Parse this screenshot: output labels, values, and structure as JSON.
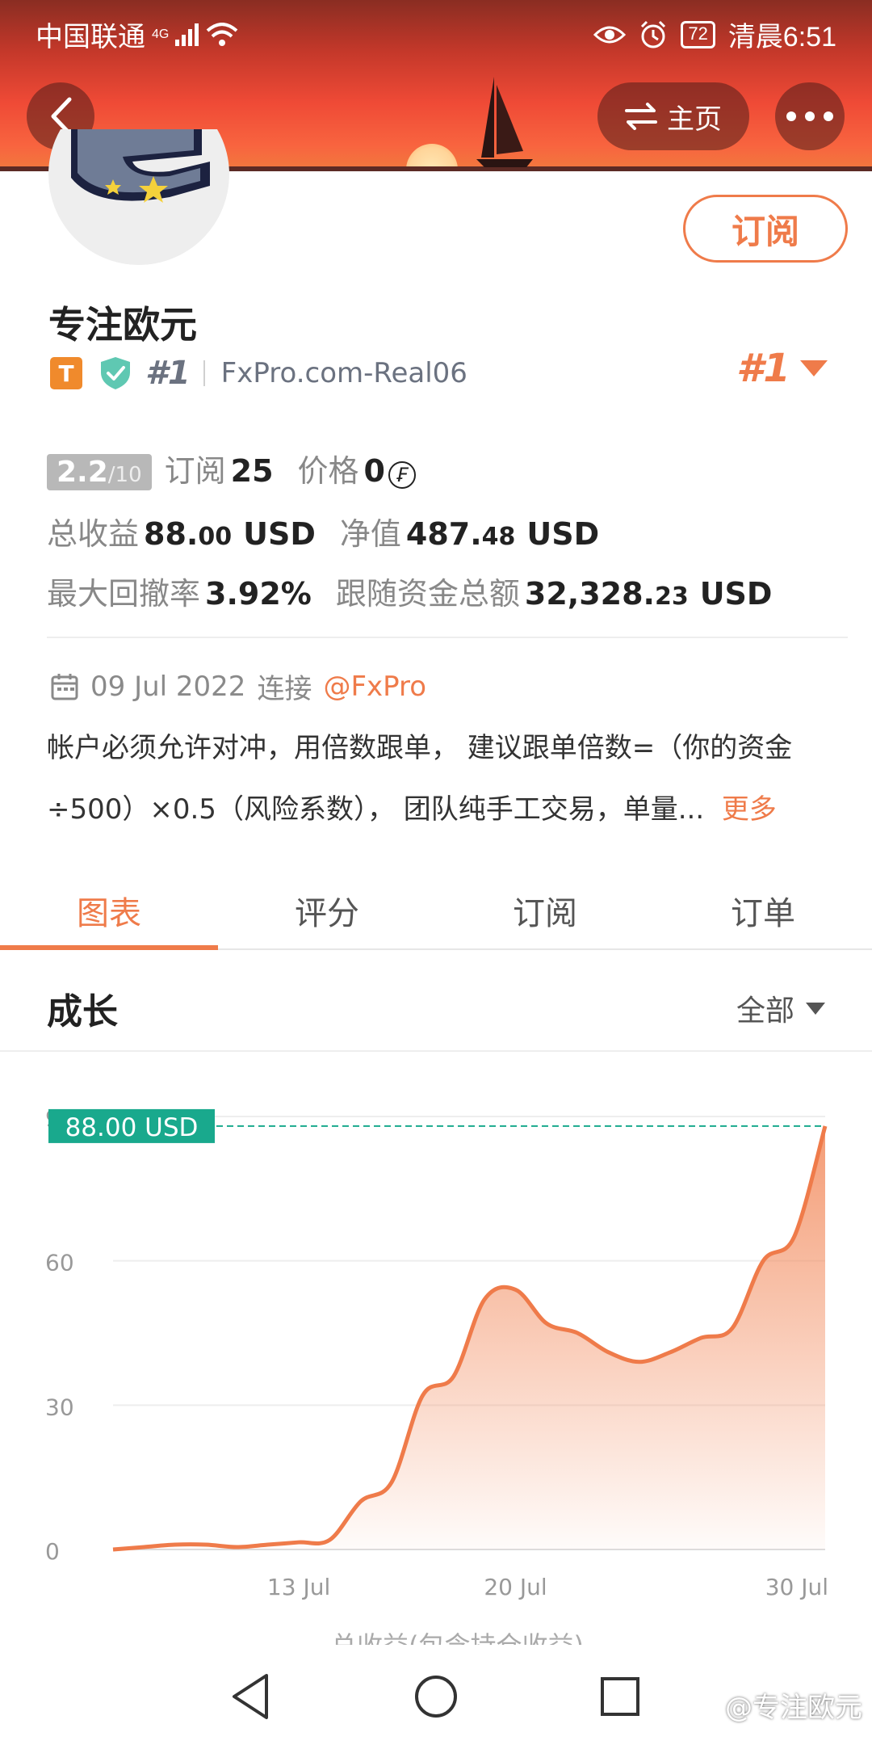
{
  "status_bar": {
    "carrier": "中国联通",
    "network": "4G",
    "battery": "72",
    "time": "清晨6:51"
  },
  "header": {
    "home_label": "主页",
    "icons": [
      "back-icon",
      "swap-icon",
      "more-icon"
    ]
  },
  "profile": {
    "subscribe_label": "订阅",
    "name": "专注欧元",
    "badge_t": "T",
    "rank_small": "#1",
    "server": "FxPro.com-Real06",
    "rank_big": "#1"
  },
  "stats": {
    "rating": "2.2",
    "rating_max": "/10",
    "subs_label": "订阅",
    "subs_value": "25",
    "price_label": "价格",
    "price_value": "0",
    "price_currency": "₣",
    "total_profit_label": "总收益",
    "total_profit_int": "88.",
    "total_profit_dec": "00",
    "total_profit_unit": "USD",
    "equity_label": "净值",
    "equity_int": "487.",
    "equity_dec": "48",
    "equity_unit": "USD",
    "drawdown_label": "最大回撤率",
    "drawdown_value": "3.92%",
    "follow_label": "跟随资金总额",
    "follow_int": "32,328.",
    "follow_dec": "23",
    "follow_unit": "USD"
  },
  "meta": {
    "date": "09 Jul 2022",
    "connect_label": "连接",
    "broker": "@FxPro"
  },
  "description": {
    "line1": "帐户必须允许对冲，用倍数跟单， 建议跟单倍数=（你的资金",
    "line2": "÷500）×0.5（风险系数）， 团队纯手工交易，单量...",
    "more": "更多"
  },
  "tabs": [
    {
      "label": "图表",
      "active": true
    },
    {
      "label": "评分",
      "active": false
    },
    {
      "label": "订阅",
      "active": false
    },
    {
      "label": "订单",
      "active": false
    }
  ],
  "section": {
    "title": "成长",
    "filter": "全部"
  },
  "chart_data": {
    "type": "area",
    "x": [
      "Jul 7",
      "Jul 8",
      "Jul 9",
      "Jul 10",
      "Jul 11",
      "Jul 12",
      "Jul 13",
      "Jul 14",
      "Jul 15",
      "Jul 16",
      "Jul 17",
      "Jul 18",
      "Jul 19",
      "Jul 20",
      "Jul 21",
      "Jul 22",
      "Jul 23",
      "Jul 24",
      "Jul 25",
      "Jul 26",
      "Jul 27",
      "Jul 28",
      "Jul 29",
      "Jul 30"
    ],
    "values": [
      0,
      0.5,
      1,
      1,
      0.5,
      1,
      1.5,
      2,
      10,
      14,
      32,
      36,
      52,
      54,
      47,
      45,
      41,
      39,
      41,
      44,
      46,
      60,
      65,
      88
    ],
    "x_ticks": [
      "13 Jul",
      "20 Jul",
      "30 Jul"
    ],
    "x_tick_index": [
      6,
      13,
      23
    ],
    "y_ticks": [
      0,
      30,
      60,
      90
    ],
    "y_tick_labels": [
      "0",
      "30",
      "60",
      "90"
    ],
    "ylim": [
      0,
      90
    ],
    "current_label": "88.00 USD",
    "current_value": 88,
    "line_color": "#ef7b4a",
    "marker_color": "#19a98d",
    "grid": true
  },
  "chart_footer": "总收益(包含持仓收益)",
  "navbar": {
    "icons": [
      "back-nav-icon",
      "home-nav-icon",
      "recents-nav-icon"
    ]
  },
  "watermark": "@专注欧元"
}
